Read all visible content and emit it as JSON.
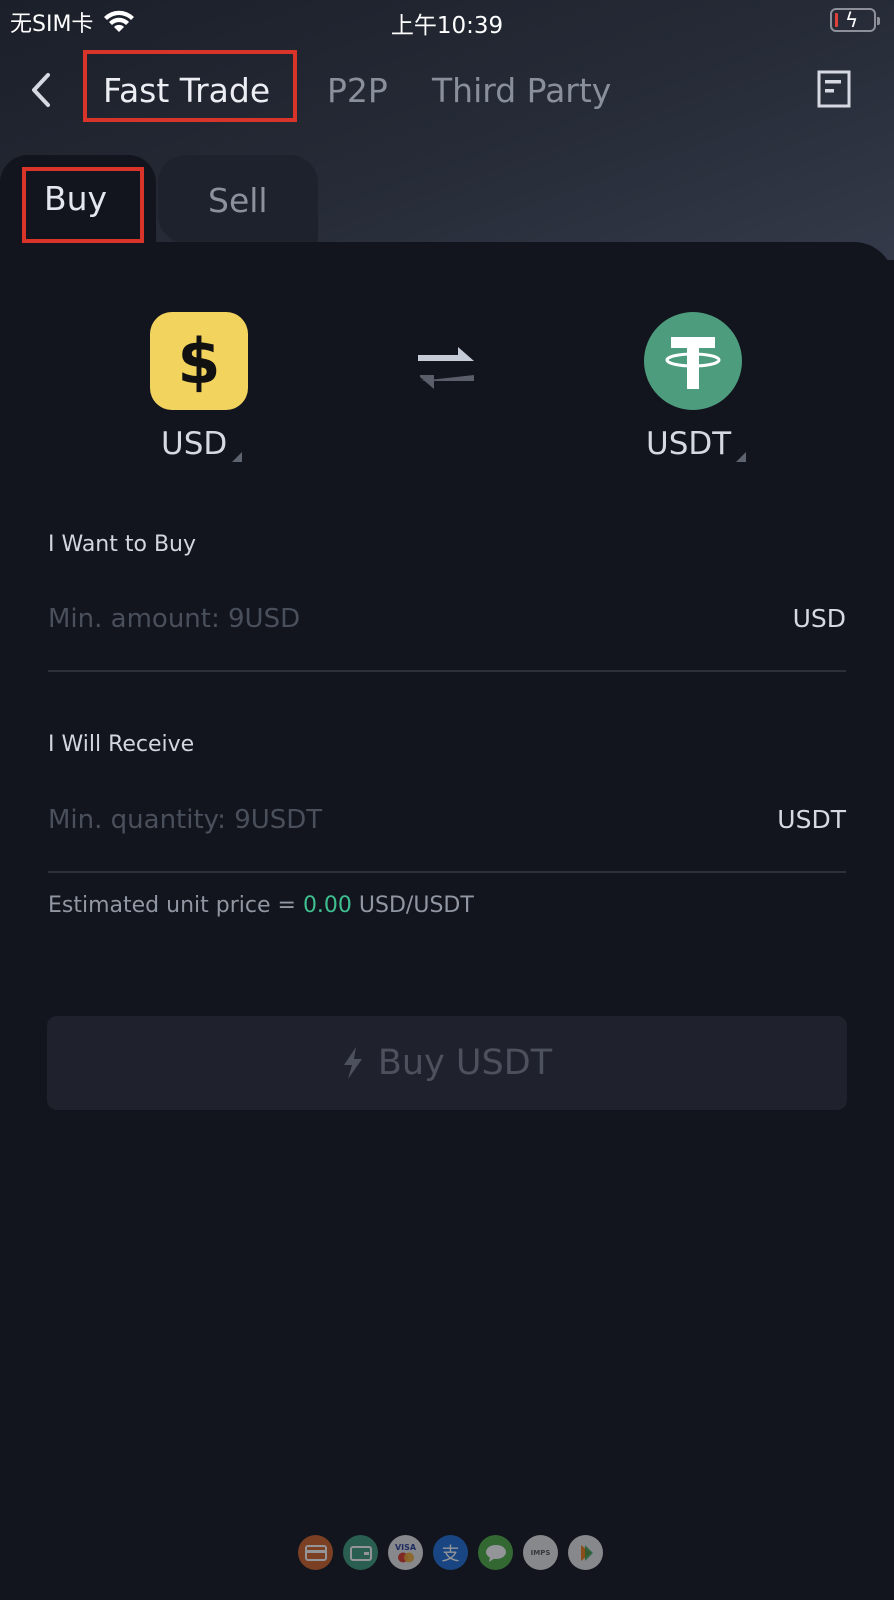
{
  "status_bar": {
    "carrier": "无SIM卡",
    "time": "上午10:39",
    "battery_level_percent": 5,
    "charging": true
  },
  "nav": {
    "tabs": [
      {
        "label": "Fast Trade",
        "active": true
      },
      {
        "label": "P2P",
        "active": false
      },
      {
        "label": "Third Party",
        "active": false
      }
    ]
  },
  "trade_tabs": [
    {
      "label": "Buy",
      "active": true
    },
    {
      "label": "Sell",
      "active": false
    }
  ],
  "pair": {
    "from": {
      "symbol": "USD",
      "icon_glyph": "$",
      "color": "#f2d35e"
    },
    "to": {
      "symbol": "USDT",
      "icon_glyph": "T",
      "color": "#4e9c7e"
    }
  },
  "form": {
    "buy": {
      "label": "I Want to Buy",
      "placeholder": "Min. amount: 9USD",
      "value": "",
      "unit": "USD"
    },
    "receive": {
      "label": "I Will Receive",
      "placeholder": "Min. quantity: 9USDT",
      "value": "",
      "unit": "USDT"
    },
    "estimate": {
      "prefix": "Estimated unit price =",
      "value": "0.00",
      "suffix": "USD/USDT"
    }
  },
  "action": {
    "label": "Buy USDT"
  },
  "payment_methods": [
    {
      "name": "bank-card",
      "color": "#d1632a",
      "glyph": "▭"
    },
    {
      "name": "wallet",
      "color": "#3d9b7a",
      "glyph": "▣"
    },
    {
      "name": "visa-mastercard",
      "color": "#e6e6e6",
      "glyph": "VISA"
    },
    {
      "name": "alipay",
      "color": "#1f6fd6",
      "glyph": "支"
    },
    {
      "name": "wechat",
      "color": "#4ead45",
      "glyph": "💬"
    },
    {
      "name": "imps",
      "color": "#e6e6e6",
      "glyph": "IMPS"
    },
    {
      "name": "upi",
      "color": "#e6e6e6",
      "glyph": "▶"
    }
  ],
  "colors": {
    "accent_green": "#3fbf8f",
    "highlight_box": "#d8342a",
    "background": "#12151d"
  }
}
